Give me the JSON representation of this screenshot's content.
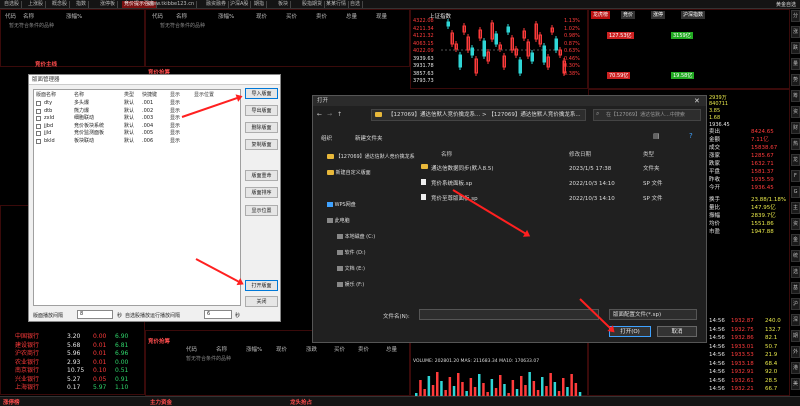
{
  "top_tabs": [
    "自选股",
    "上涨股",
    "概念股",
    "指数",
    "涨停板",
    "竞价提示强度",
    "www.tkibbe123.cn",
    "融资融券",
    "沪深A股",
    "期指",
    "板块",
    "股指期货",
    "某某行情",
    "自选"
  ],
  "top_right": "黄金自选",
  "panel_headers": [
    "代码",
    "名称",
    "涨幅%",
    "现价",
    "涨跌",
    "买价",
    "卖价",
    "总量",
    "现量"
  ],
  "panel_header_short": [
    "代码",
    "名称",
    "涨幅%",
    "现价",
    "涨跌",
    "卖价",
    "总量",
    "现量"
  ],
  "empty_text": "暂无符合条件的品种",
  "panel_titles": {
    "p1": "竞价主线",
    "p2": "竞价抢筹",
    "p3": "分时",
    "p4": "竞价抢筹",
    "p5": "龙头抢占"
  },
  "stock_list": [
    {
      "name": "中国银行",
      "price": "3.20",
      "chg": "0.00",
      "change": "6.90"
    },
    {
      "name": "建设银行",
      "price": "5.68",
      "chg": "0.01",
      "change": "6.81"
    },
    {
      "name": "沪农商行",
      "price": "5.96",
      "chg": "0.01",
      "change": "6.96"
    },
    {
      "name": "农业银行",
      "price": "2.93",
      "chg": "0.01",
      "change": "0.00"
    },
    {
      "name": "南京银行",
      "price": "10.75",
      "chg": "0.10",
      "change": "0.51"
    },
    {
      "name": "兴业银行",
      "price": "5.27",
      "chg": "0.05",
      "change": "0.91"
    },
    {
      "name": "上海银行",
      "price": "0.17",
      "chg": "5.97",
      "change": "1.10"
    }
  ],
  "chart_prices": [
    "4322.08",
    "4211.34",
    "4121.32",
    "4063.15",
    "4022.09",
    "3939.63",
    "3931.78",
    "3857.63",
    "3793.73"
  ],
  "chart_pcts": [
    "1.13%",
    "1.02%",
    "0.98%",
    "0.87%",
    "0.63%",
    "0.46%",
    "0.30%",
    "0.38%"
  ],
  "chart_low": [
    "3745.20",
    "3637.29",
    "3652.03",
    "3576.91"
  ],
  "chart_title": "上证指数",
  "chart_vol": "VOLUME: 202801.20 MAS: 211683.34 MA10: 170633.07",
  "right_tabs": [
    "龙虎榜",
    "竞价",
    "涨停",
    "沪深指数"
  ],
  "right_labels": [
    "上涨",
    "下跌",
    "平盘",
    "涨停"
  ],
  "right_badges": [
    "127.53亿",
    "3159亿",
    "70.59亿",
    "19.58亿"
  ],
  "right_vals": [
    "2939万",
    "840711",
    "3.85",
    "1.68",
    "1936.45"
  ],
  "right_rows": [
    {
      "k": "卖出",
      "v": "8424.65"
    },
    {
      "k": "金额",
      "v": "7.11亿"
    },
    {
      "k": "成交",
      "v": "15838.67"
    },
    {
      "k": "涨家",
      "v": "1285.67"
    },
    {
      "k": "跌家",
      "v": "1632.71"
    },
    {
      "k": "平盘",
      "v": "1581.37"
    },
    {
      "k": "昨收",
      "v": "1935.59"
    },
    {
      "k": "今开",
      "v": "1936.45"
    }
  ],
  "right_rows2": [
    {
      "k": "换手",
      "v": "23.88/1.18%"
    },
    {
      "k": "量比",
      "v": "147.95亿"
    },
    {
      "k": "振幅",
      "v": "2839.7亿"
    },
    {
      "k": "均价",
      "v": "1551.86"
    },
    {
      "k": "市盈",
      "v": "1947.88"
    }
  ],
  "ticks": [
    {
      "t": "14:56",
      "p": "1932.87",
      "v": "240.0"
    },
    {
      "t": "14:56",
      "p": "1932.75",
      "v": "132.7"
    },
    {
      "t": "14:56",
      "p": "1932.86",
      "v": "82.1"
    },
    {
      "t": "14:56",
      "p": "1933.01",
      "v": "50.7"
    },
    {
      "t": "14:56",
      "p": "1933.53",
      "v": "21.9"
    },
    {
      "t": "14:56",
      "p": "1933.18",
      "v": "68.4"
    },
    {
      "t": "14:56",
      "p": "1932.91",
      "v": "92.0"
    },
    {
      "t": "14:56",
      "p": "1932.61",
      "v": "28.5"
    },
    {
      "t": "14:56",
      "p": "1932.21",
      "v": "66.7"
    }
  ],
  "mgr": {
    "title": "版面管理器",
    "cols": [
      "版面名称",
      "名称",
      "类型",
      "快捷键",
      "显示",
      "显示位置"
    ],
    "rows": [
      {
        "a": "dty",
        "b": "多头爆",
        "c": "默认",
        "d": ".001",
        "e": "显示"
      },
      {
        "a": "dtb",
        "b": "熊力爆",
        "c": "默认",
        "d": ".002",
        "e": "显示"
      },
      {
        "a": "zxld",
        "b": "细胞联动",
        "c": "默认",
        "d": ".003",
        "e": "显示"
      },
      {
        "a": "jjbd",
        "b": "竞价板块系统",
        "c": "默认",
        "d": ".004",
        "e": "显示"
      },
      {
        "a": "jjld",
        "b": "竞价监测面板",
        "c": "默认",
        "d": ".005",
        "e": "显示"
      },
      {
        "a": "bkld",
        "b": "板块联动",
        "c": "默认",
        "d": ".006",
        "e": "显示"
      }
    ],
    "buttons": [
      "导入版面",
      "导出版面",
      "删除版面",
      "复制版面",
      "版面重命",
      "版面排序",
      "显示位置",
      "打开版面",
      "关闭"
    ],
    "footer_label1": "版面播放间隔",
    "footer_val1": "8",
    "footer_unit1": "秒",
    "footer_label2": "自选股播放运行播放间隔",
    "footer_val2": "6",
    "footer_unit2": "秒"
  },
  "dlg": {
    "title": "打开",
    "path": "【127069】通达信默人竞价擒龙系...  >  【127069】通达信默人竞价擒龙系...",
    "search_placeholder": "在【127069】通达信默人...中搜索",
    "organize": "组织",
    "new_folder": "新建文件夹",
    "nav": [
      "【127069】通达信默人竞价擒龙系",
      "新建自定义版面",
      "WPS网盘",
      "此电脑",
      "本地磁盘 (C:)",
      "软件 (D:)",
      "文档 (E:)",
      "娱乐 (F:)"
    ],
    "cols": [
      "名称",
      "修改日期",
      "类型"
    ],
    "files": [
      {
        "name": "通达信数据同步(默人8.5)",
        "date": "2023/1/5 17:38",
        "type": "文件夹",
        "folder": true
      },
      {
        "name": "竞价系统面板.sp",
        "date": "2022/10/3 14:10",
        "type": "SP 文件",
        "folder": false
      },
      {
        "name": "竞价至尊版面板.sp",
        "date": "2022/10/3 14:10",
        "type": "SP 文件",
        "folder": false
      }
    ],
    "filename_label": "文件名(N):",
    "filetype": "版面配置文件(*.sp)",
    "open": "打开(O)",
    "cancel": "取消"
  },
  "side_buttons": [
    "分",
    "涨",
    "跌",
    "量",
    "势",
    "筹",
    "资",
    "财",
    "热",
    "龙",
    "F",
    "G",
    "主",
    "资",
    "金",
    "统",
    "选",
    "基",
    "沪",
    "深",
    "期",
    "外",
    "港",
    "美"
  ],
  "status": {
    "left": "涨停榜",
    "mid": "主力资金",
    "right": "龙头抢占"
  }
}
